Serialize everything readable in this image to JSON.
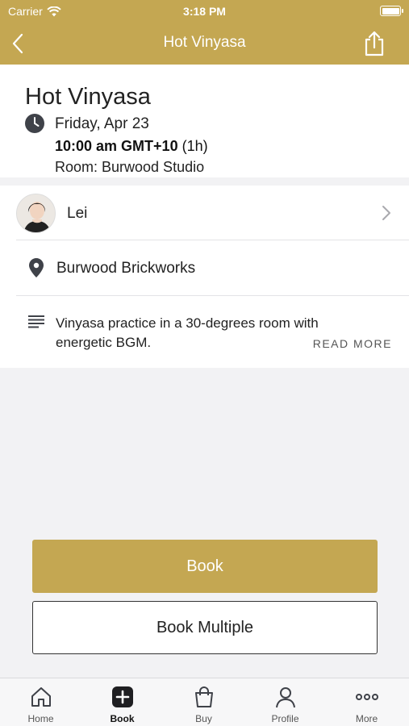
{
  "status_bar": {
    "carrier": "Carrier",
    "time": "3:18 PM"
  },
  "nav": {
    "title": "Hot Vinyasa",
    "back_icon": "chevron-left-icon",
    "share_icon": "share-icon"
  },
  "class": {
    "title": "Hot Vinyasa",
    "date": "Friday, Apr 23",
    "time": "10:00 am GMT+10",
    "duration": "(1h)",
    "room": "Room: Burwood Studio"
  },
  "instructor": {
    "name": "Lei"
  },
  "location": {
    "name": "Burwood Brickworks"
  },
  "description": {
    "text": "Vinyasa practice in a 30-degrees room with energetic BGM.",
    "read_more": "READ MORE"
  },
  "actions": {
    "book": "Book",
    "book_multiple": "Book Multiple"
  },
  "tabs": [
    {
      "label": "Home",
      "icon": "home-icon"
    },
    {
      "label": "Book",
      "icon": "plus-square-icon",
      "active": true
    },
    {
      "label": "Buy",
      "icon": "shopping-bag-icon"
    },
    {
      "label": "Profile",
      "icon": "person-icon"
    },
    {
      "label": "More",
      "icon": "more-dots-icon"
    }
  ],
  "colors": {
    "brand": "#c4a752",
    "background": "#f2f2f4"
  }
}
